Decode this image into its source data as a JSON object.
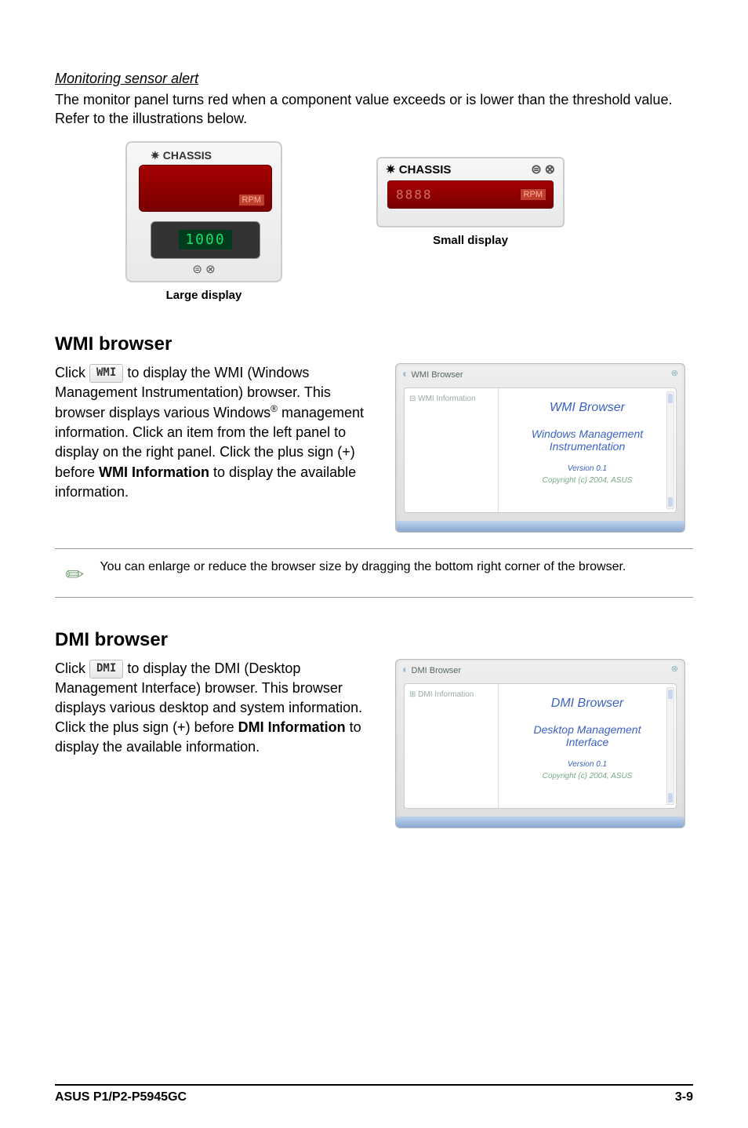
{
  "monitoring": {
    "heading": "Monitoring sensor alert",
    "body": "The monitor panel turns red when a component value exceeds or is lower than the threshold value. Refer to the illustrations below.",
    "large_caption": "Large display",
    "small_caption": "Small display",
    "sensor_label": "CHASSIS",
    "rpm_label": "RPM",
    "seg_value": "1000",
    "seg_small": "8888"
  },
  "wmi": {
    "heading": "WMI browser",
    "chip": "WMI",
    "p1a": "Click ",
    "p1b": " to display the WMI (Windows Management Instrumentation) browser. This browser displays various Windows",
    "p1c": " management information. Click an item from the left panel to display on the right panel. Click the plus sign (+) before ",
    "p1_bold": "WMI Information",
    "p1d": " to display the available information.",
    "window_title": "WMI Browser",
    "tree_root": "⊟ WMI Information",
    "content_title": "WMI Browser",
    "content_sub1": "Windows Management",
    "content_sub2": "Instrumentation",
    "content_ver": "Version 0.1",
    "content_copy": "Copyright (c) 2004, ASUS"
  },
  "note": "You can enlarge or reduce the browser size by dragging the bottom right corner of the browser.",
  "dmi": {
    "heading": "DMI browser",
    "chip": "DMI",
    "p1a": "Click ",
    "p1b": " to display the DMI (Desktop Management Interface) browser. This browser displays various desktop and system information. Click the plus sign (+) before ",
    "p1_bold": "DMI Information",
    "p1c": " to display the available information.",
    "window_title": "DMI Browser",
    "tree_root": "⊞ DMI Information",
    "content_title": "DMI Browser",
    "content_sub1": "Desktop Management",
    "content_sub2": "Interface",
    "content_ver": "Version 0.1",
    "content_copy": "Copyright (c) 2004, ASUS"
  },
  "footer": {
    "left": "ASUS P1/P2-P5945GC",
    "right": "3-9"
  }
}
